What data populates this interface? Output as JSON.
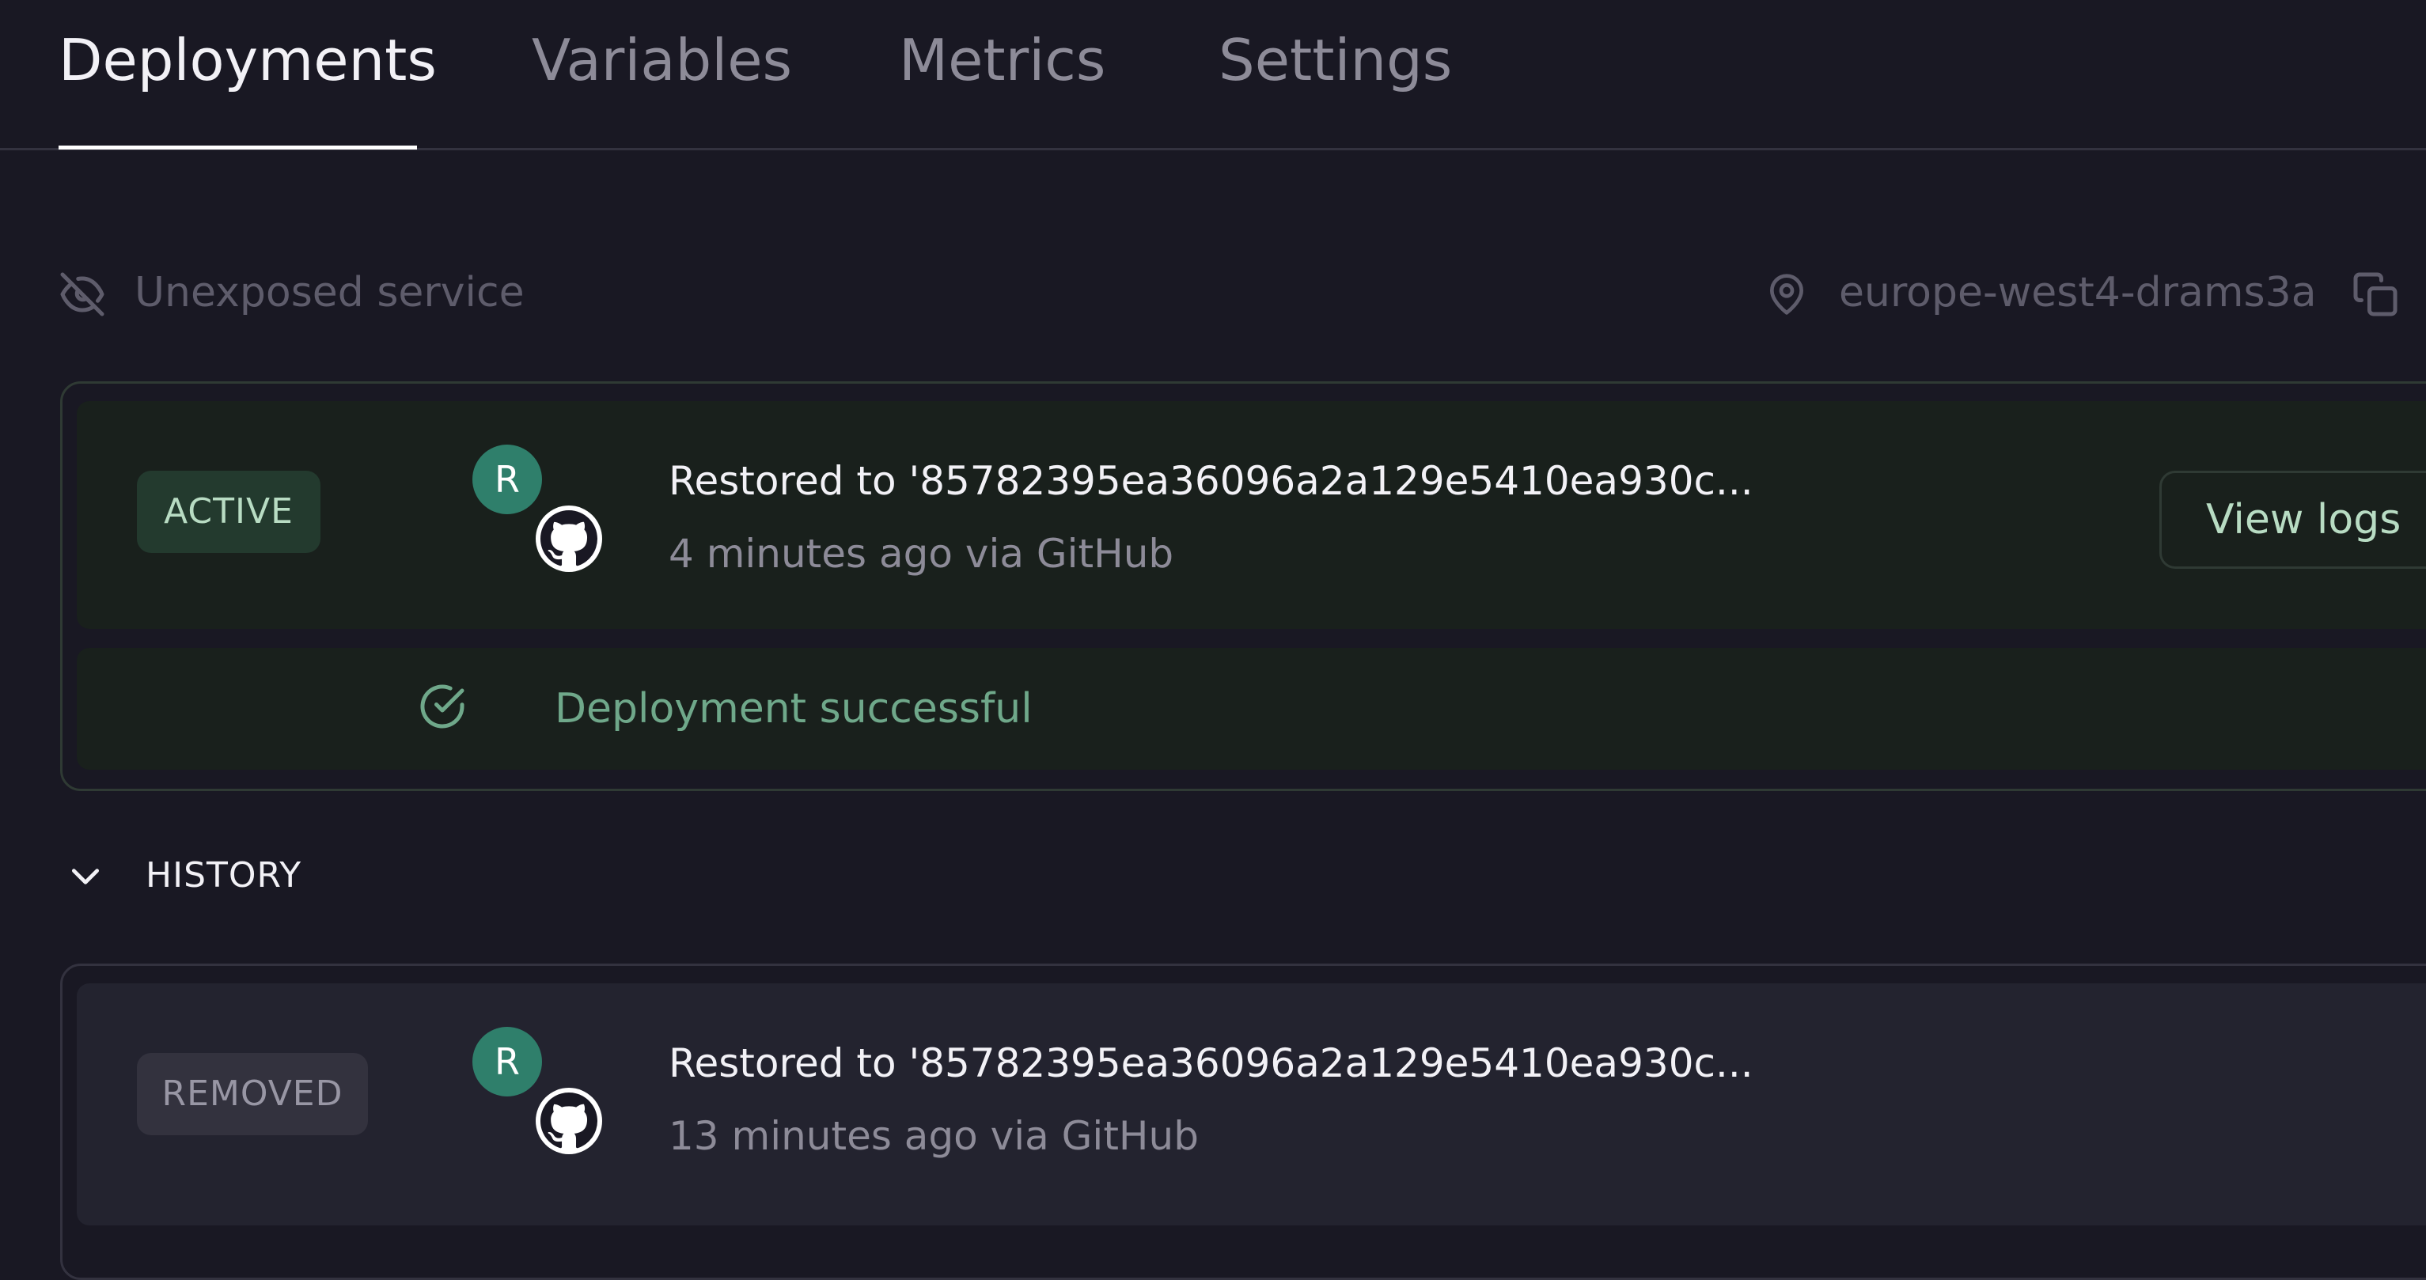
{
  "tabs": [
    {
      "label": "Deployments",
      "active": true
    },
    {
      "label": "Variables",
      "active": false
    },
    {
      "label": "Metrics",
      "active": false
    },
    {
      "label": "Settings",
      "active": false
    }
  ],
  "service": {
    "exposure_label": "Unexposed service",
    "region": "europe-west4-drams3a"
  },
  "active_deployment": {
    "status": "ACTIVE",
    "avatar_initial": "R",
    "commit_title": "Restored to '85782395ea36096a2a129e5410ea930c...",
    "meta": "4 minutes ago via GitHub",
    "view_logs_label": "View logs",
    "status_message": "Deployment successful"
  },
  "history": {
    "label": "HISTORY",
    "items": [
      {
        "status": "REMOVED",
        "avatar_initial": "R",
        "commit_title": "Restored to '85782395ea36096a2a129e5410ea930c...",
        "meta": "13 minutes ago via GitHub"
      }
    ]
  },
  "colors": {
    "background": "#191823",
    "active_accent": "#6fa88a",
    "avatar": "#2f7f6b"
  }
}
